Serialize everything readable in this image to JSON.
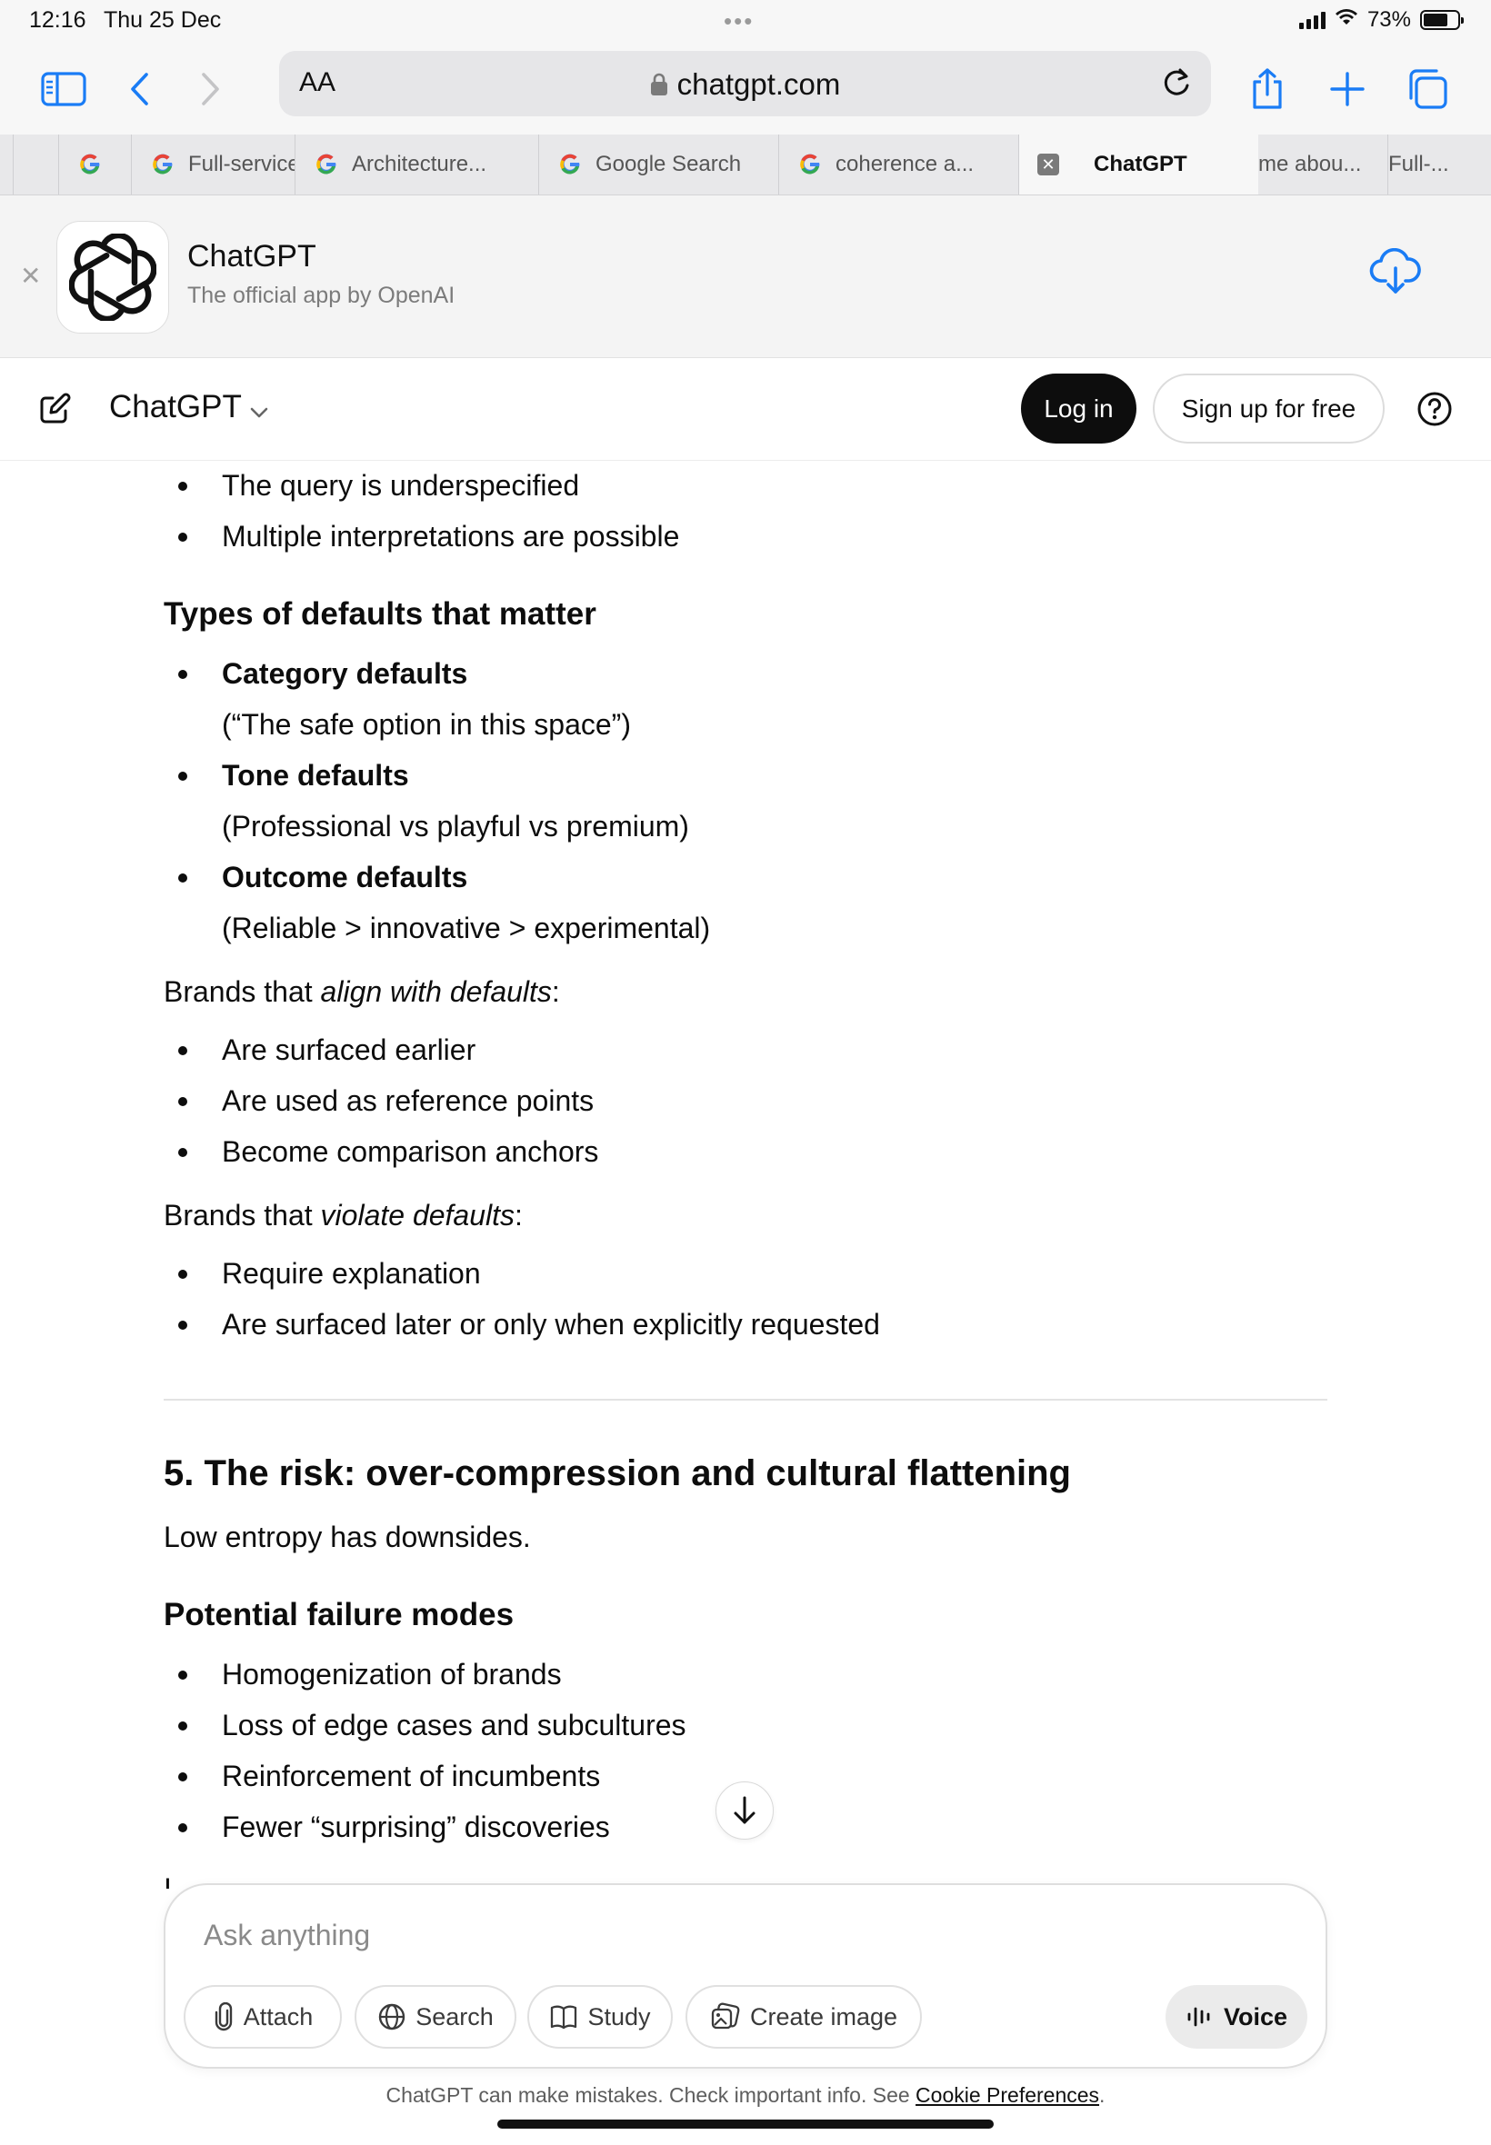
{
  "status_bar": {
    "time": "12:16",
    "date": "Thu 25 Dec",
    "dots": "•••",
    "battery": "73%",
    "battery_level": 0.73
  },
  "toolbar": {
    "text_size_label": "AA",
    "url": "chatgpt.com"
  },
  "tabs": [
    {
      "label": ""
    },
    {
      "label": "Full-service"
    },
    {
      "label": "Architecture..."
    },
    {
      "label": "Google Search"
    },
    {
      "label": "coherence a..."
    },
    {
      "label": "ChatGPT"
    },
    {
      "label": "me abou..."
    },
    {
      "label": "Full-..."
    }
  ],
  "banner": {
    "title": "ChatGPT",
    "subtitle": "The official app by OpenAI"
  },
  "header": {
    "title": "ChatGPT",
    "login_label": "Log in",
    "signup_label": "Sign up for free"
  },
  "content": {
    "top_bullets": [
      "The query is underspecified",
      "Multiple interpretations are possible"
    ],
    "types_heading": "Types of defaults that matter",
    "default_types": [
      {
        "name": "Category defaults",
        "desc": "(“The safe option in this space”)"
      },
      {
        "name": "Tone defaults",
        "desc": "(Professional vs playful vs premium)"
      },
      {
        "name": "Outcome defaults",
        "desc": "(Reliable > innovative > experimental)"
      }
    ],
    "align_prefix": "Brands that ",
    "align_em": "align with defaults",
    "align_suffix": ":",
    "align_bullets": [
      "Are surfaced earlier",
      "Are used as reference points",
      "Become comparison anchors"
    ],
    "violate_prefix": "Brands that ",
    "violate_em": "violate defaults",
    "violate_suffix": ":",
    "violate_bullets": [
      "Require explanation",
      "Are surfaced later or only when explicitly requested"
    ],
    "section_heading": "5. The risk: over-compression and cultural flattening",
    "section_intro": "Low entropy has downsides.",
    "failure_heading": "Potential failure modes",
    "failure_bullets": [
      "Homogenization of brands",
      "Loss of edge cases and subcultures",
      "Reinforcement of incumbents",
      "Fewer “surprising” discoveries"
    ],
    "cut_off_text": "I"
  },
  "composer": {
    "placeholder": "Ask anything",
    "attach_label": "Attach",
    "search_label": "Search",
    "study_label": "Study",
    "create_image_label": "Create image",
    "voice_label": "Voice"
  },
  "footer": {
    "disclaimer": "ChatGPT can make mistakes. Check important info. See ",
    "cookie_link": "Cookie Preferences",
    "disclaimer_end": "."
  },
  "colors": {
    "accent_blue": "#1a7cf5",
    "login_bg": "#0d0d0d"
  }
}
